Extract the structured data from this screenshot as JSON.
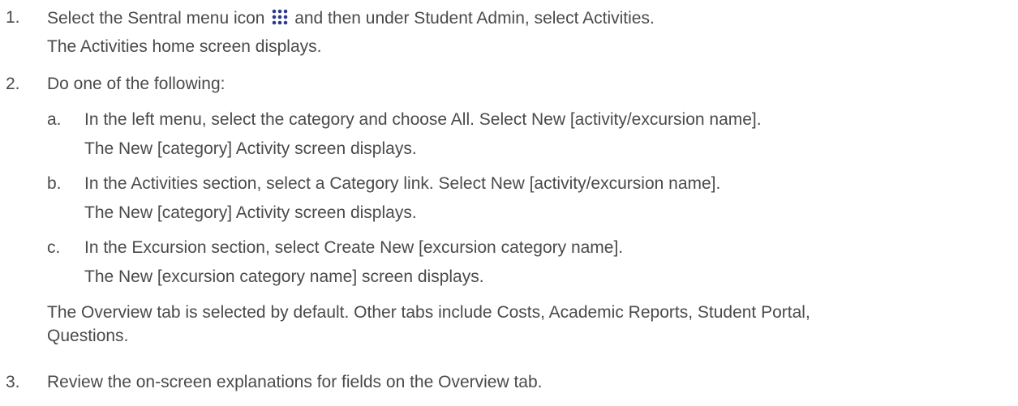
{
  "steps": [
    {
      "number": "1.",
      "text_before_icon": "Select the Sentral menu icon",
      "icon": "grid-menu-icon",
      "text_after_icon": "and then under Student Admin, select Activities.",
      "result": "The Activities home screen displays."
    },
    {
      "number": "2.",
      "text": "Do one of the following:",
      "substeps": [
        {
          "letter": "a.",
          "text": "In the left menu, select the category and choose All. Select New [activity/excursion name].",
          "result": "The New [category] Activity screen displays."
        },
        {
          "letter": "b.",
          "text": "In the Activities section, select a Category link. Select New [activity/excursion name].",
          "result": "The New [category] Activity screen displays."
        },
        {
          "letter": "c.",
          "text": "In the Excursion section, select Create New [excursion category name].",
          "result": "The New [excursion category name] screen displays."
        }
      ],
      "note_line1": "The Overview tab is selected by default. Other tabs include Costs, Academic Reports, Student Portal,",
      "note_line2": "Questions."
    },
    {
      "number": "3.",
      "text": "Review the on-screen explanations for fields on the Overview tab."
    }
  ],
  "colors": {
    "text": "#4a4a4a",
    "icon": "#2e3a8c"
  }
}
